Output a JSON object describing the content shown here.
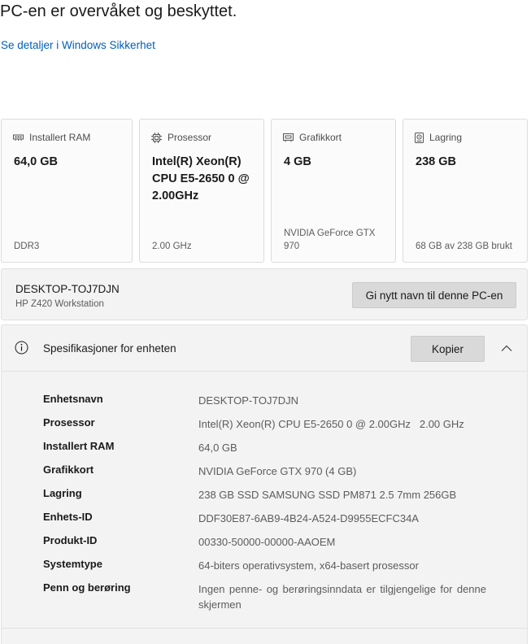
{
  "status": {
    "title": "PC-en er overvåket og beskyttet.",
    "link": "Se detaljer i Windows Sikkerhet"
  },
  "cards": [
    {
      "label": "Installert RAM",
      "icon": "ram-icon",
      "value": "64,0 GB",
      "sub": "DDR3"
    },
    {
      "label": "Prosessor",
      "icon": "processor-icon",
      "value": "Intel(R) Xeon(R) CPU E5-2650 0 @ 2.00GHz",
      "sub": "2.00 GHz"
    },
    {
      "label": "Grafikkort",
      "icon": "graphics-card-icon",
      "value": "4 GB",
      "sub": "NVIDIA GeForce GTX 970"
    },
    {
      "label": "Lagring",
      "icon": "storage-icon",
      "value": "238 GB",
      "sub": "68 GB av 238 GB brukt"
    }
  ],
  "device": {
    "name": "DESKTOP-TOJ7DJN",
    "model": "HP Z420 Workstation",
    "rename_label": "Gi nytt navn til denne PC-en"
  },
  "specs": {
    "title": "Spesifikasjoner for enheten",
    "copy_label": "Kopier",
    "rows": [
      {
        "label": "Enhetsnavn",
        "value": "DESKTOP-TOJ7DJN"
      },
      {
        "label": "Prosessor",
        "value": "Intel(R) Xeon(R) CPU E5-2650 0 @ 2.00GHz   2.00 GHz"
      },
      {
        "label": "Installert RAM",
        "value": "64,0 GB"
      },
      {
        "label": "Grafikkort",
        "value": "NVIDIA GeForce GTX 970 (4 GB)"
      },
      {
        "label": "Lagring",
        "value": "238 GB SSD SAMSUNG SSD PM871 2.5 7mm 256GB"
      },
      {
        "label": "Enhets-ID",
        "value": "DDF30E87-6AB9-4B24-A524-D9955ECFC34A"
      },
      {
        "label": "Produkt-ID",
        "value": "00330-50000-00000-AAOEM"
      },
      {
        "label": "Systemtype",
        "value": "64-biters operativsystem, x64-basert prosessor"
      },
      {
        "label": "Penn og berøring",
        "value": "Ingen penne- og berøringsinndata er tilgjengelige for denne skjermen"
      }
    ]
  },
  "colors": {
    "accent_link": "#005fb8",
    "panel_bg": "#f3f3f3",
    "button_bg": "#d9d9d9"
  }
}
